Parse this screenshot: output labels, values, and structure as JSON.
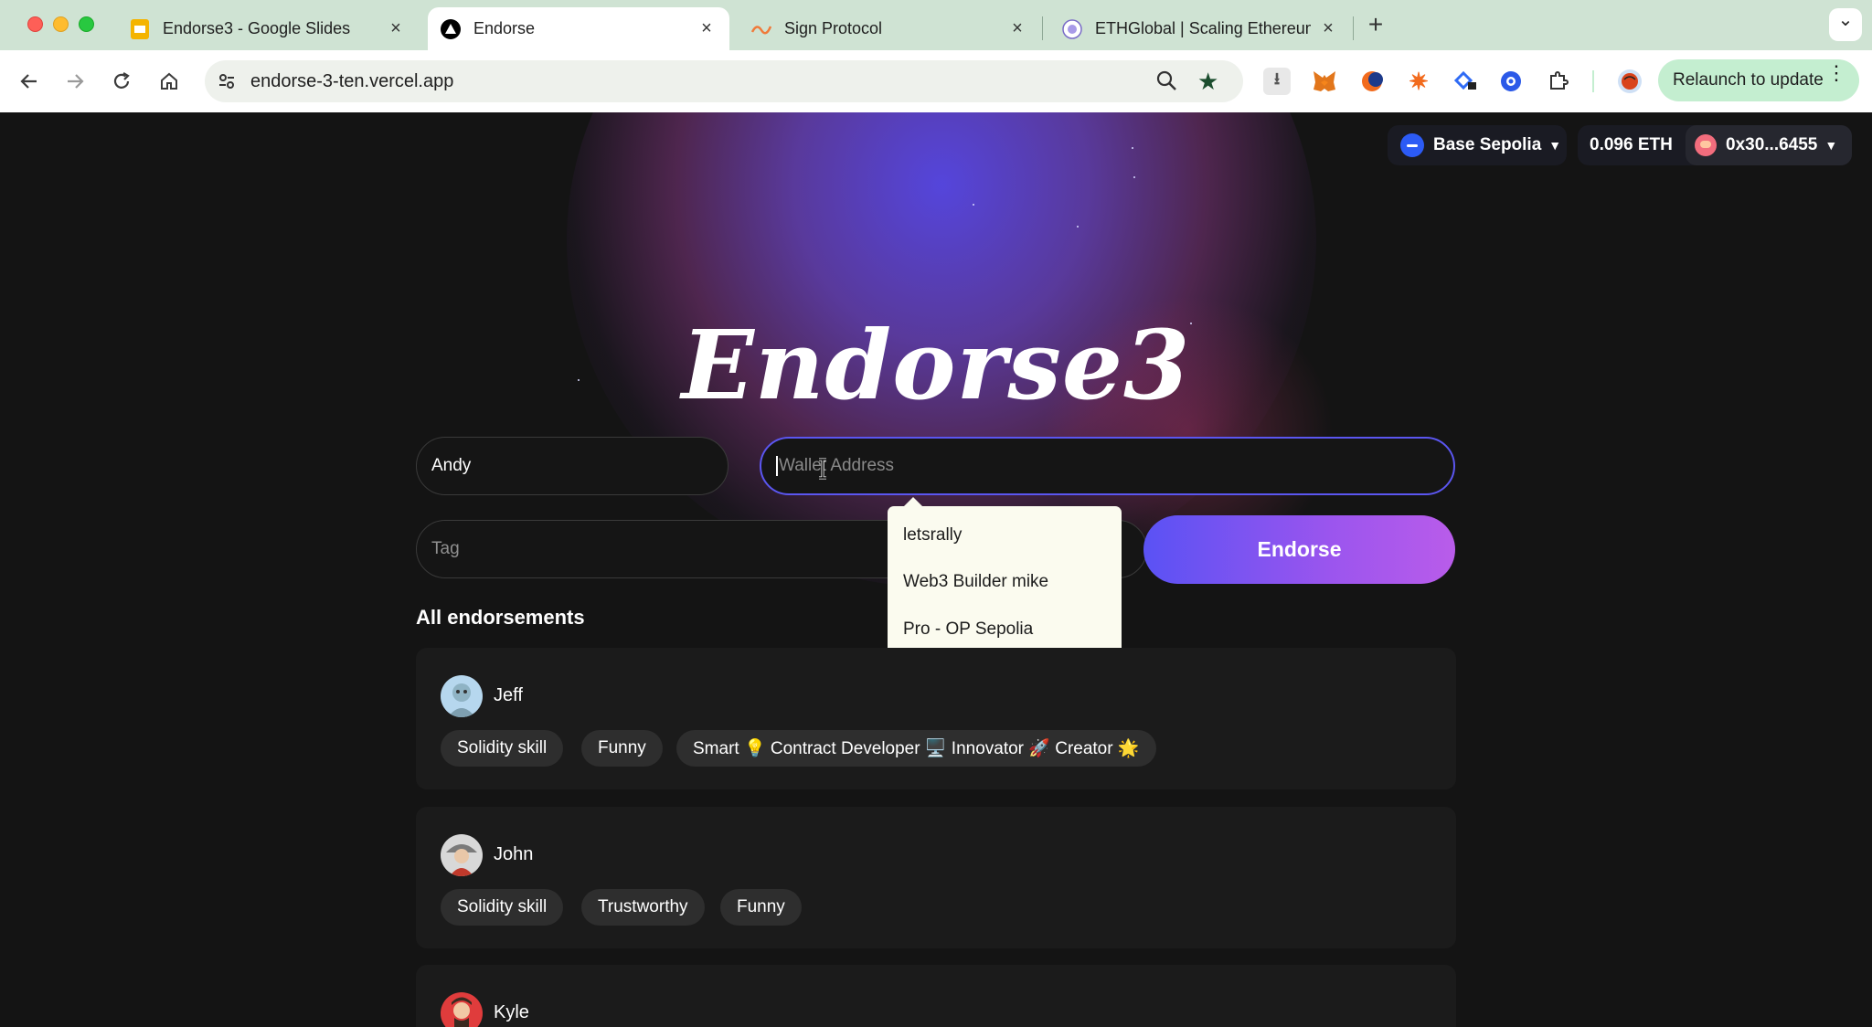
{
  "browser": {
    "tabs": [
      {
        "title": "Endorse3 - Google Slides",
        "close": "×"
      },
      {
        "title": "Endorse",
        "close": "×"
      },
      {
        "title": "Sign Protocol",
        "close": "×"
      },
      {
        "title": "ETHGlobal | Scaling Ethereum",
        "close": "×"
      }
    ],
    "new_tab": "+",
    "tab_search": "⌄",
    "url": "endorse-3-ten.vercel.app",
    "relaunch_label": "Relaunch to update"
  },
  "wallet": {
    "network": "Base Sepolia",
    "balance": "0.096 ETH",
    "account": "0x30...6455"
  },
  "app": {
    "logo": "Endorse3",
    "name_value": "Andy",
    "wallet_placeholder": "Wallet Address",
    "tag_placeholder": "Tag",
    "endorse_label": "Endorse",
    "suggestions": [
      "letsrally",
      "Web3 Builder mike",
      "Pro - OP Sepolia"
    ],
    "section_title": "All endorsements",
    "endorsements": [
      {
        "name": "Jeff",
        "tags": [
          "Solidity skill",
          "Funny",
          "Smart 💡 Contract Developer 🖥️ Innovator 🚀 Creator 🌟"
        ]
      },
      {
        "name": "John",
        "tags": [
          "Solidity skill",
          "Trustworthy",
          "Funny"
        ]
      },
      {
        "name": "Kyle",
        "tags": []
      }
    ]
  },
  "colors": {
    "accent": "#5b56f0",
    "button_gradient_start": "#5a52f4",
    "button_gradient_end": "#b95cea",
    "background": "#141414"
  }
}
